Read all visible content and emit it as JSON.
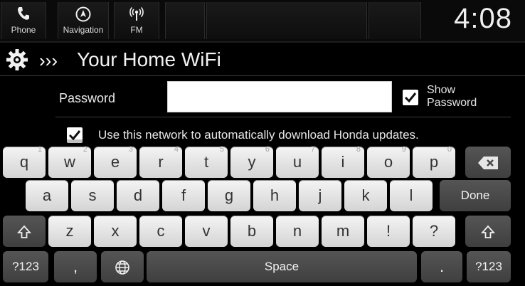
{
  "topbar": {
    "tabs": [
      {
        "label": "Phone",
        "icon": "phone-icon"
      },
      {
        "label": "Navigation",
        "icon": "navigation-icon"
      },
      {
        "label": "FM",
        "icon": "radio-icon"
      }
    ],
    "clock": "4:08"
  },
  "header": {
    "title": "Your Home WiFi",
    "icon": "gear-icon",
    "breadcrumb_icon": "chevrons-right-icon",
    "breadcrumb_symbol": "›››"
  },
  "form": {
    "password_label": "Password",
    "password_value": "",
    "show_password_line1": "Show",
    "show_password_line2": "Password",
    "show_password_checked": true,
    "use_network_text": "Use this network to automatically download Honda updates.",
    "use_network_checked": true
  },
  "keyboard": {
    "row1": [
      {
        "k": "q",
        "h": "1"
      },
      {
        "k": "w",
        "h": "2"
      },
      {
        "k": "e",
        "h": "3"
      },
      {
        "k": "r",
        "h": "4"
      },
      {
        "k": "t",
        "h": "5"
      },
      {
        "k": "y",
        "h": "6"
      },
      {
        "k": "u",
        "h": "7"
      },
      {
        "k": "i",
        "h": "8"
      },
      {
        "k": "o",
        "h": "9"
      },
      {
        "k": "p",
        "h": "0"
      }
    ],
    "row2": [
      "a",
      "s",
      "d",
      "f",
      "g",
      "h",
      "j",
      "k",
      "l"
    ],
    "row3": [
      "z",
      "x",
      "c",
      "v",
      "b",
      "n",
      "m",
      "!",
      "?"
    ],
    "done": "Done",
    "sym": "?123",
    "comma": ",",
    "space": "Space",
    "period": ".",
    "icons": {
      "backspace": "backspace-icon",
      "shift": "shift-icon",
      "globe": "globe-icon"
    }
  }
}
